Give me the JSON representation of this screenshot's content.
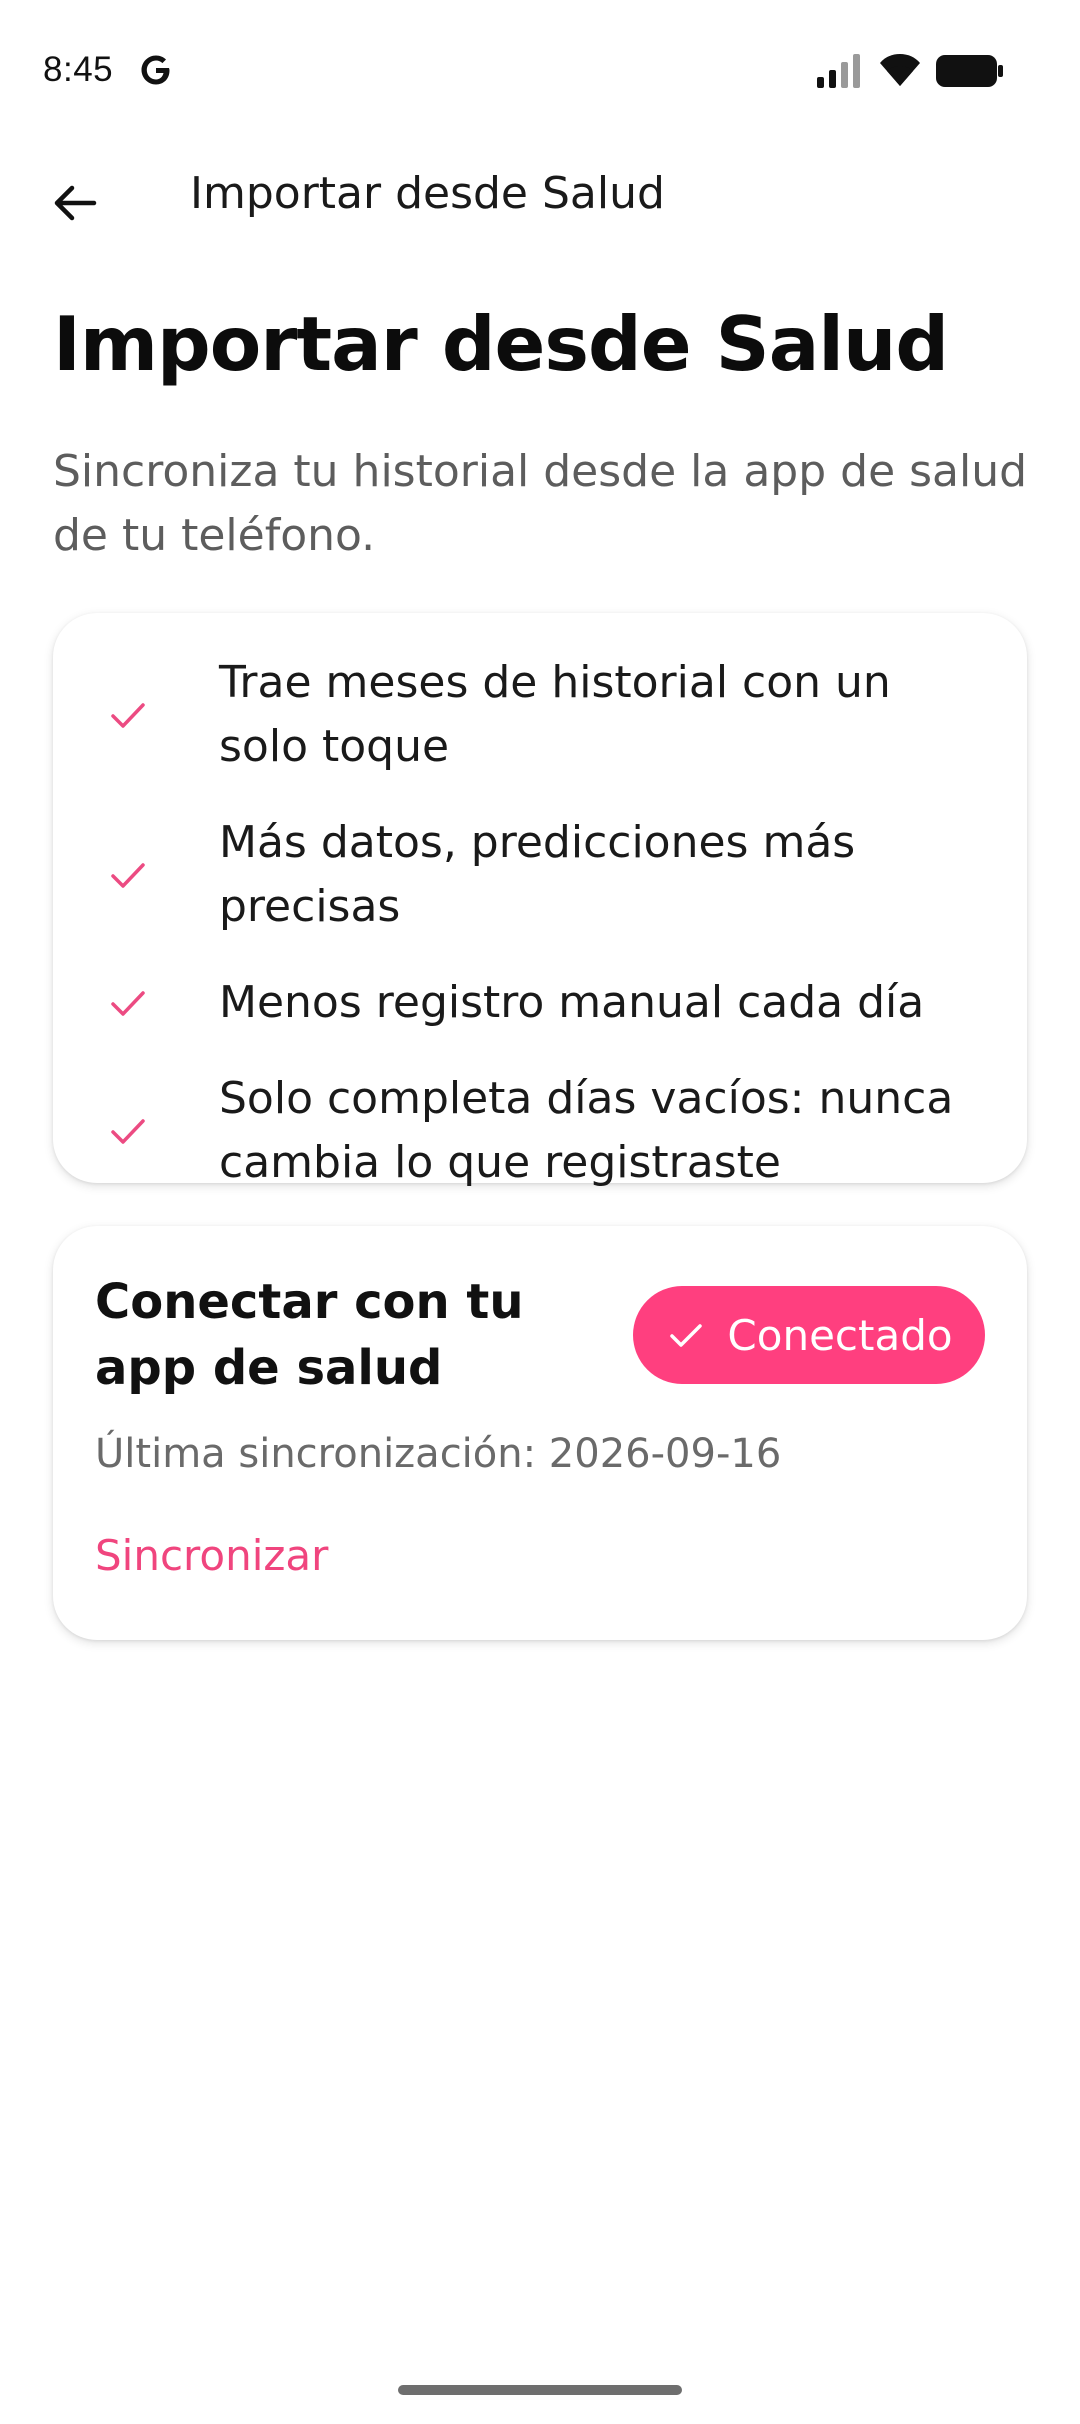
{
  "status_bar": {
    "time": "8:45",
    "icons": [
      "google-icon",
      "signal-icon",
      "wifi-icon",
      "battery-icon"
    ]
  },
  "app_bar": {
    "back_icon": "arrow-left-icon",
    "title": "Importar desde Salud"
  },
  "main": {
    "title": "Importar desde Salud",
    "subtitle": "Sincroniza tu historial desde la app de salud de tu teléfono.",
    "benefits": [
      {
        "text": "Trae meses de historial con un solo toque"
      },
      {
        "text": "Más datos, predicciones más precisas"
      },
      {
        "text": "Menos registro manual cada día"
      },
      {
        "text": "Solo completa días vacíos: nunca cambia lo que registraste"
      }
    ]
  },
  "connect_card": {
    "title": "Conectar con tu app de salud",
    "button_label": "Conectado",
    "last_sync": "Última sincronización: 2026-09-16",
    "sync_link": "Sincronizar"
  },
  "colors": {
    "accent": "#ff3f7f",
    "link": "#f0457e",
    "check": "#ec4b82"
  }
}
